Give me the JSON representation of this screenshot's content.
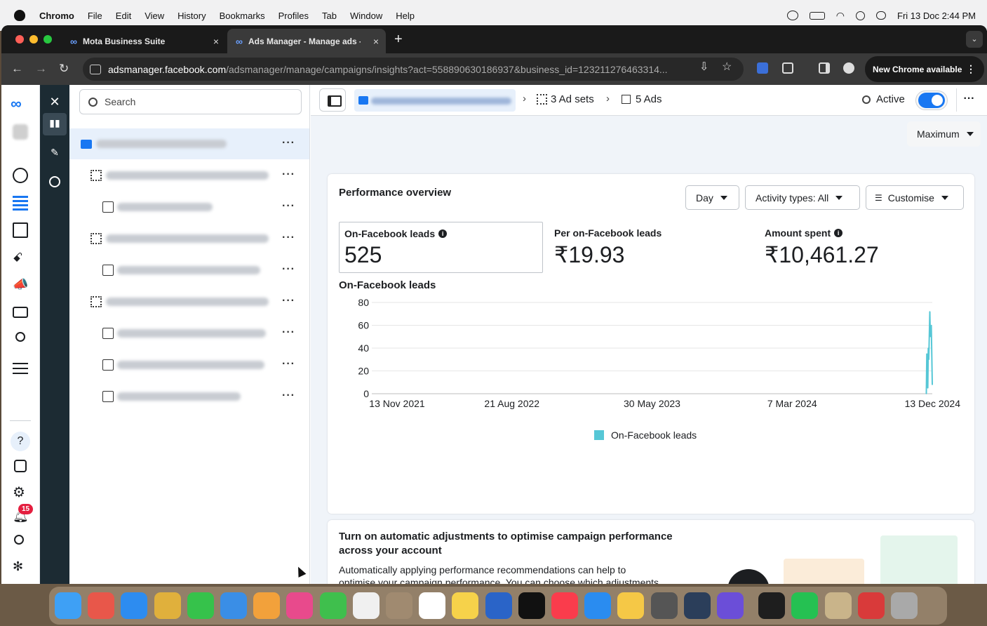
{
  "menubar": {
    "app": "Chromo",
    "items": [
      "File",
      "Edit",
      "View",
      "History",
      "Bookmarks",
      "Profiles",
      "Tab",
      "Window",
      "Help"
    ],
    "clock": "Fri 13 Doc  2:44 PM"
  },
  "browser": {
    "tabs": [
      {
        "label": "Mota Business Suite",
        "close": "×"
      },
      {
        "label": "Ads Manager - Manage ads -",
        "close": "×"
      }
    ],
    "new_tab": "+",
    "url_host": "adsmanager.facebook.com",
    "url_path": "/adsmanager/manage/campaigns/insights?act=558890630186937&business_id=123211276463314...",
    "new_chrome_label": "New Chrome available"
  },
  "sidebar": {
    "search_placeholder": "Search",
    "notification_count": "15",
    "help_label": "?"
  },
  "breadcrumb": {
    "ad_sets": "3 Ad sets",
    "ads": "5 Ads",
    "status": "Active"
  },
  "date_range": "Maximum",
  "performance": {
    "title": "Performance overview",
    "day_label": "Day",
    "activity_label": "Activity types: All",
    "customise_label": "Customise",
    "metrics": [
      {
        "label": "On-Facebook leads",
        "value": "525"
      },
      {
        "label": "Per on-Facebook leads",
        "value": "₹19.93"
      },
      {
        "label": "Amount spent",
        "value": "₹10,461.27"
      }
    ],
    "chart_title": "On-Facebook leads"
  },
  "chart_data": {
    "type": "line",
    "title": "On-Facebook leads",
    "x_ticks": [
      "13 Nov 2021",
      "21 Aug 2022",
      "30 May 2023",
      "7 Mar 2024",
      "13 Dec 2024"
    ],
    "y_ticks": [
      0,
      20,
      40,
      60,
      80
    ],
    "ylim": [
      0,
      80
    ],
    "grid": true,
    "legend": "bottom-center",
    "series": [
      {
        "name": "On-Facebook leads",
        "color": "#56c7d6",
        "points": [
          {
            "x": "2024-12-01",
            "y": 0
          },
          {
            "x": "2024-12-02",
            "y": 35
          },
          {
            "x": "2024-12-03",
            "y": 20
          },
          {
            "x": "2024-12-04",
            "y": 5
          },
          {
            "x": "2024-12-05",
            "y": 40
          },
          {
            "x": "2024-12-06",
            "y": 30
          },
          {
            "x": "2024-12-08",
            "y": 72
          },
          {
            "x": "2024-12-09",
            "y": 50
          },
          {
            "x": "2024-12-11",
            "y": 60
          },
          {
            "x": "2024-12-13",
            "y": 8
          }
        ]
      }
    ]
  },
  "promo": {
    "title": "Turn on automatic adjustments to optimise campaign performance across your account",
    "body": "Automatically applying performance recommendations can help to optimise your campaign performance. You can choose which adjustments"
  }
}
